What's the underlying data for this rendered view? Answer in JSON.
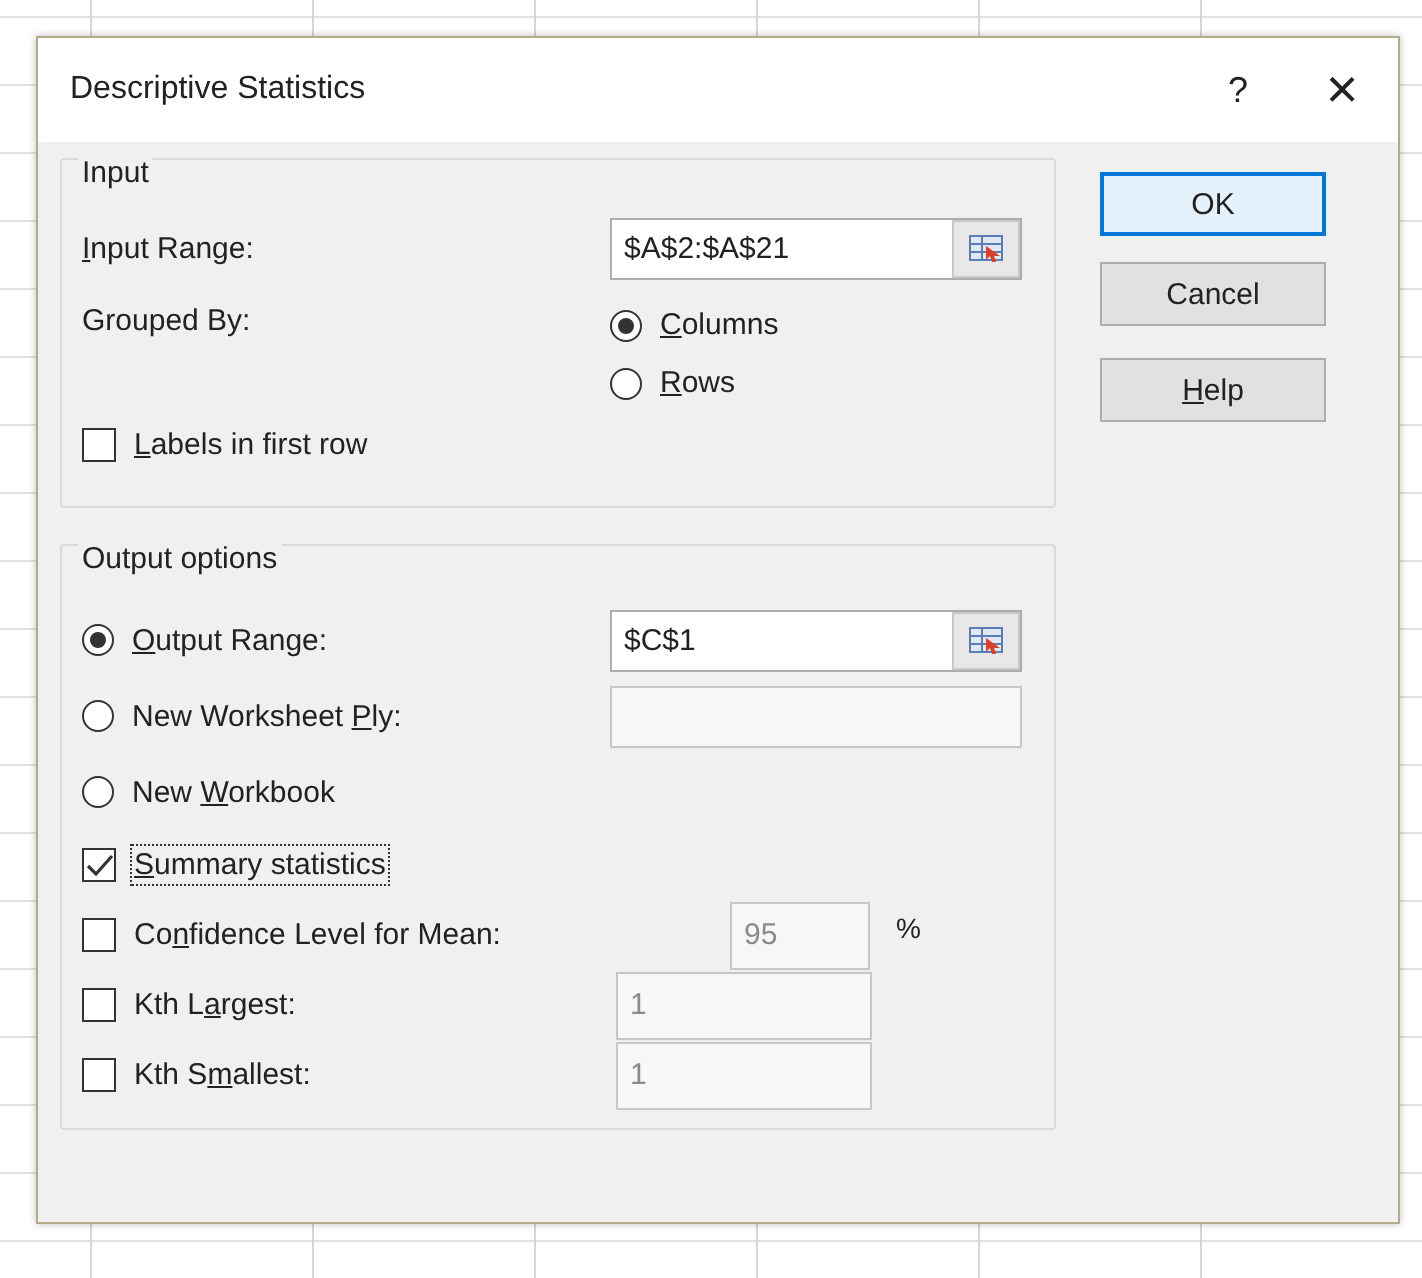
{
  "dialog": {
    "title": "Descriptive Statistics",
    "help_glyph": "?",
    "close_glyph": "×"
  },
  "input_group": {
    "title": "Input",
    "input_range": {
      "label": {
        "key": "I",
        "after": "nput Range:"
      },
      "field": {
        "value": "$A$2:$A$21",
        "disabled": false
      }
    },
    "grouped_by": {
      "label": "Grouped By:",
      "options": [
        {
          "label": {
            "key": "C",
            "after": "olumns"
          },
          "selected": true
        },
        {
          "label": {
            "key": "R",
            "after": "ows"
          },
          "selected": false
        }
      ]
    },
    "labels_checkbox": {
      "label": {
        "key": "L",
        "after": "abels in first row"
      },
      "checked": false,
      "focused": false
    }
  },
  "output_group": {
    "title": "Output options",
    "options": [
      {
        "label": {
          "key": "O",
          "after": "utput Range:"
        },
        "selected": true,
        "field": {
          "value": "$C$1",
          "disabled": false
        },
        "picker": true
      },
      {
        "label": {
          "before": "New Worksheet ",
          "key": "P",
          "after": "ly:"
        },
        "selected": false,
        "field": {
          "disabled": true
        },
        "picker": false
      },
      {
        "label": {
          "before": "New ",
          "key": "W",
          "after": "orkbook"
        },
        "selected": false
      }
    ],
    "checkboxes": [
      {
        "label": {
          "key": "S",
          "after": "ummary statistics"
        },
        "checked": true,
        "focused": true
      },
      {
        "label": {
          "before": "Co",
          "key": "n",
          "after": "fidence Level for Mean:"
        },
        "checked": false,
        "focused": false,
        "field": {
          "value": "95",
          "disabled": true
        },
        "suffix": "%",
        "kind": "short"
      },
      {
        "label": {
          "before": "Kth L",
          "key": "a",
          "after": "rgest:"
        },
        "checked": false,
        "focused": false,
        "field": {
          "value": "1",
          "disabled": true
        },
        "kind": "wide"
      },
      {
        "label": {
          "before": "Kth S",
          "key": "m",
          "after": "allest:"
        },
        "checked": false,
        "focused": false,
        "field": {
          "value": "1",
          "disabled": true
        },
        "kind": "wide"
      }
    ]
  },
  "buttons": [
    {
      "label": {
        "before": "OK"
      },
      "default": true
    },
    {
      "label": {
        "before": "Cancel"
      },
      "default": false
    },
    {
      "label": {
        "key": "H",
        "after": "elp"
      },
      "default": false
    }
  ]
}
